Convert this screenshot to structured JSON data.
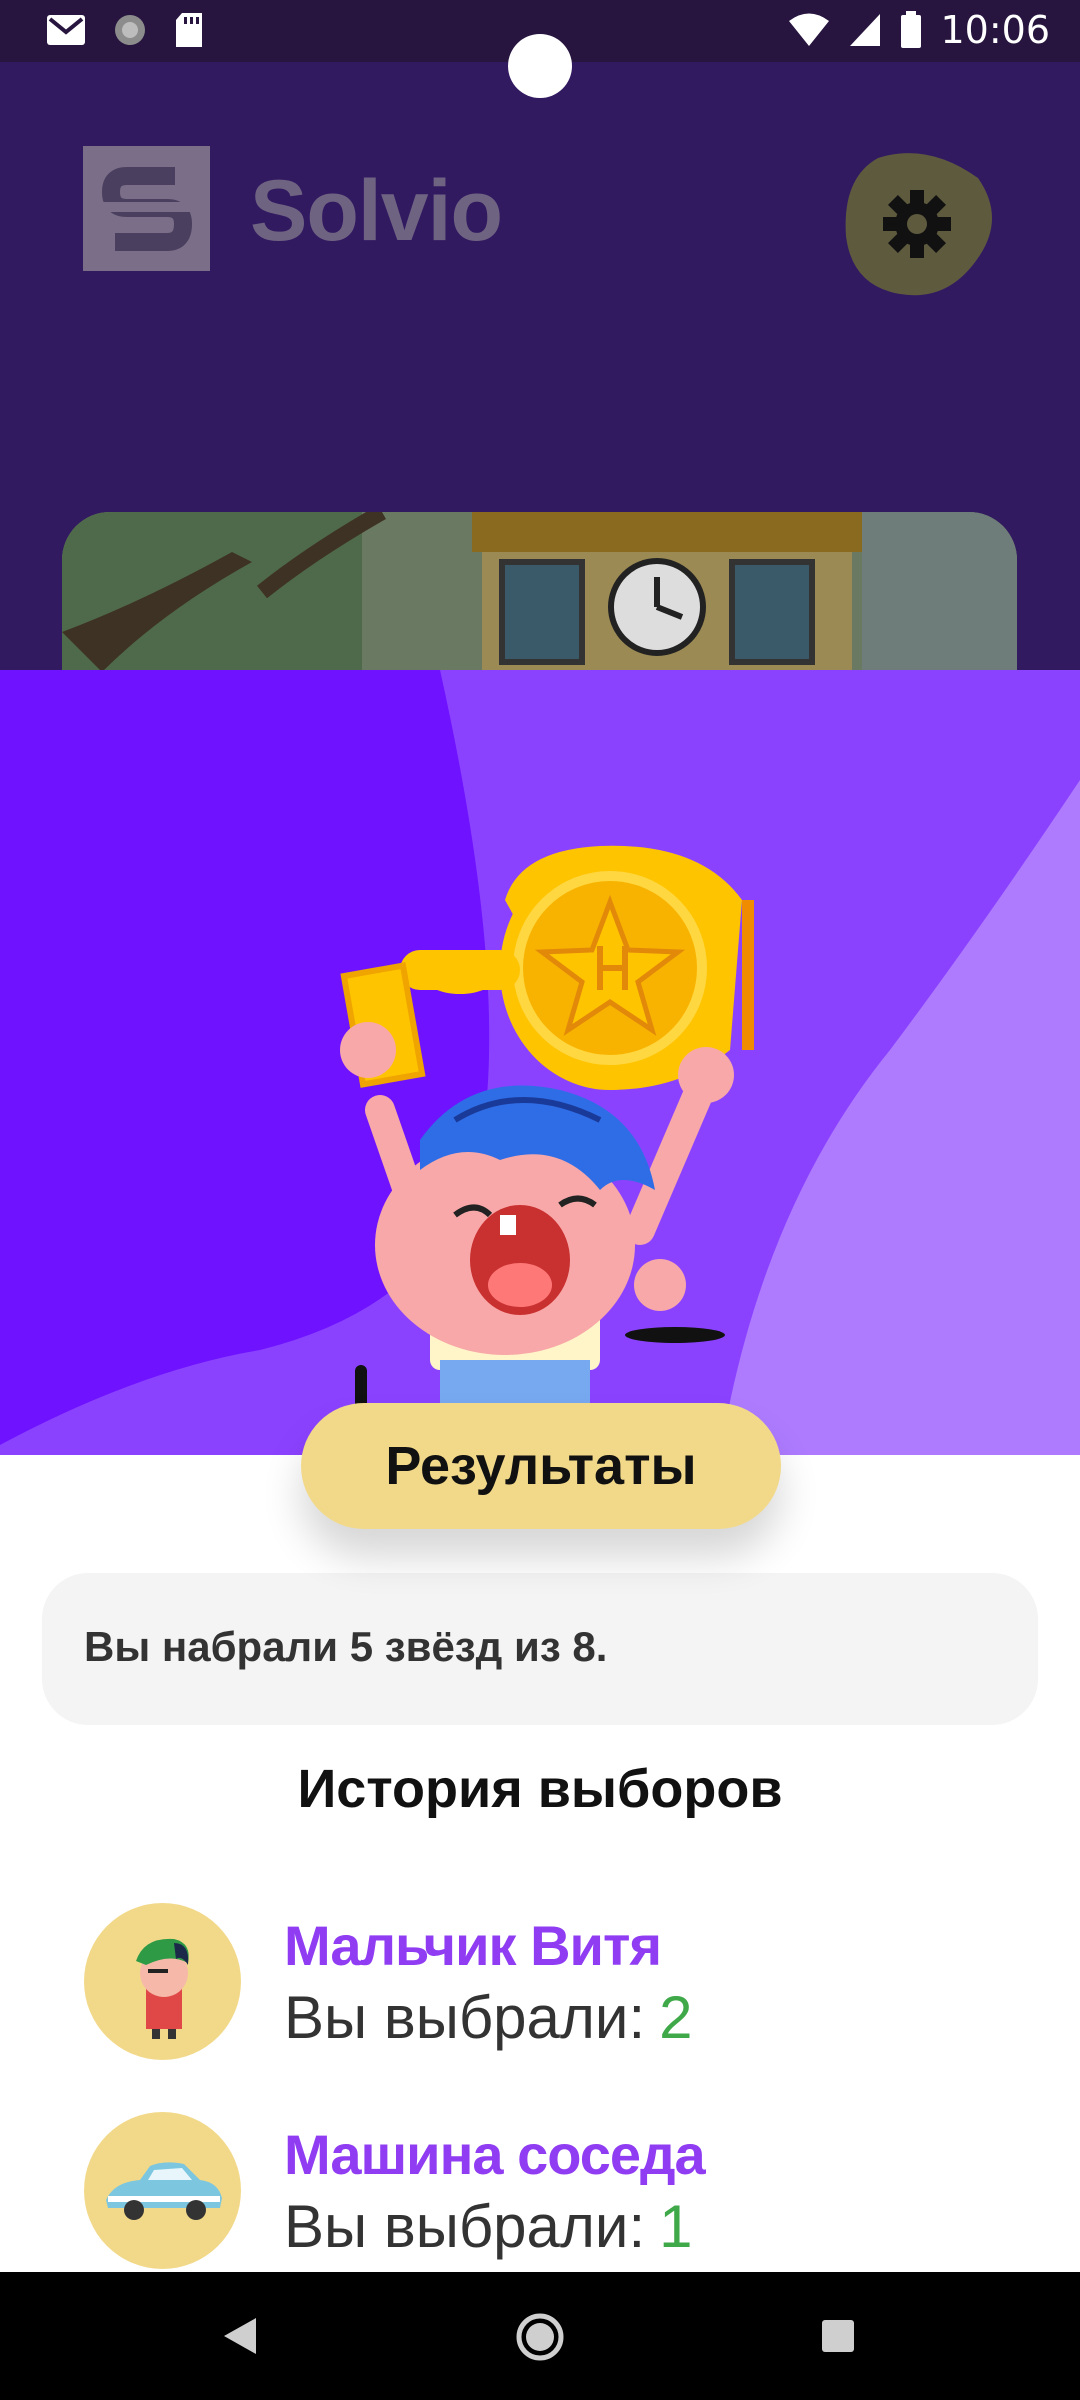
{
  "status_bar": {
    "time": "10:06",
    "left_icons": [
      "gmail-icon",
      "sync-icon",
      "sd-card-icon"
    ],
    "right_icons": [
      "wifi-icon",
      "signal-icon",
      "battery-icon"
    ]
  },
  "app": {
    "title": "Solvio",
    "settings_icon": "gear-icon"
  },
  "dialog": {
    "results_label": "Результаты",
    "score_text": "Вы набрали 5 звёзд из 8.",
    "history_title": "История выборов",
    "history": [
      {
        "name": "Мальчик Витя",
        "choice_label": "Вы выбрали:",
        "choice_value": "2",
        "avatar": "boy-avatar"
      },
      {
        "name": "Машина соседа",
        "choice_label": "Вы выбрали:",
        "choice_value": "1",
        "avatar": "car-avatar"
      }
    ]
  },
  "colors": {
    "primary": "#6f12ff",
    "accent_yellow": "#f2d98a",
    "name_purple": "#8f3cf2",
    "choice_green": "#3fa94a"
  },
  "nav": {
    "back_icon": "back-icon",
    "home_icon": "home-icon",
    "recents_icon": "recents-icon"
  }
}
